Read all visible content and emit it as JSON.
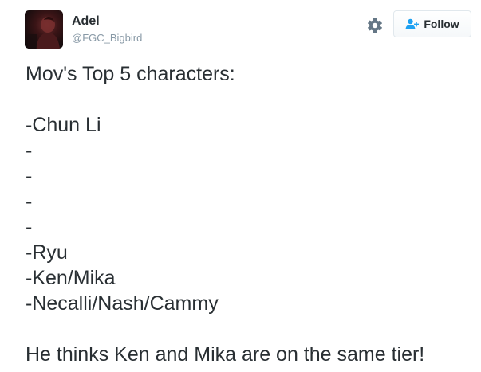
{
  "user": {
    "name": "Adel",
    "handle": "@FGC_Bigbird"
  },
  "actions": {
    "settings_icon": "gear-icon",
    "follow_icon": "add-user-icon",
    "follow_label": "Follow"
  },
  "tweet": {
    "lines": [
      "Mov's Top 5 characters:",
      "",
      "-Chun Li",
      "-",
      "-",
      "-",
      "-",
      "-Ryu",
      "-Ken/Mika",
      "-Necalli/Nash/Cammy",
      "",
      "He thinks Ken and Mika are on the same tier!"
    ]
  },
  "colors": {
    "name": "#292f33",
    "handle": "#8899a6",
    "follow_icon": "#1da1f2",
    "gear": "#657786"
  }
}
